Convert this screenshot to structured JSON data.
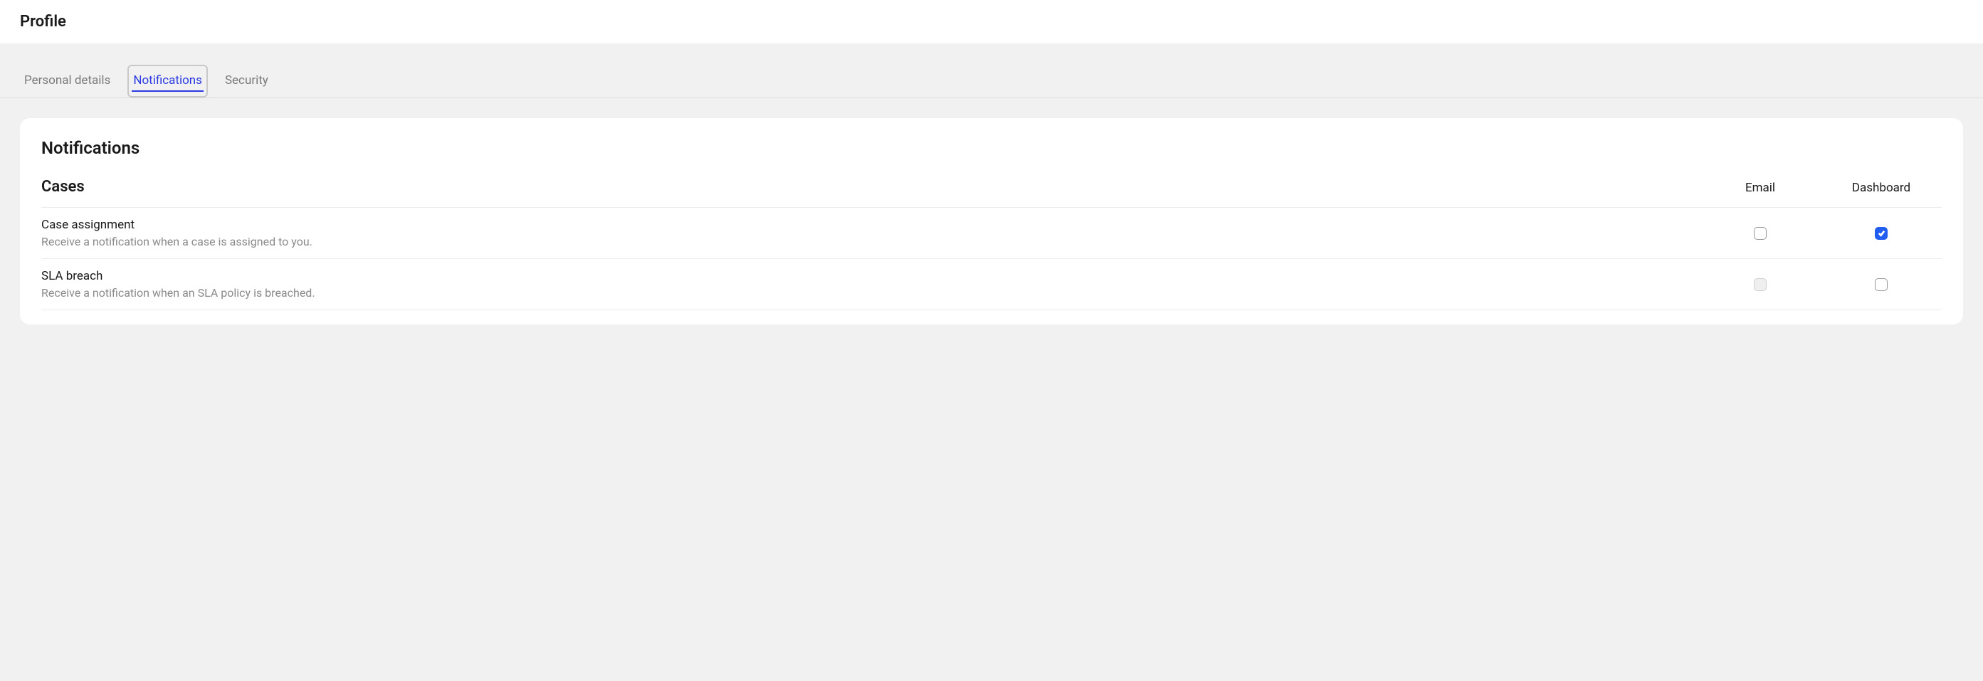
{
  "header": {
    "title": "Profile"
  },
  "tabs": {
    "items": [
      {
        "label": "Personal details",
        "active": false
      },
      {
        "label": "Notifications",
        "active": true
      },
      {
        "label": "Security",
        "active": false
      }
    ]
  },
  "card": {
    "title": "Notifications",
    "section": {
      "title": "Cases",
      "columns": {
        "email": "Email",
        "dashboard": "Dashboard"
      },
      "rows": [
        {
          "title": "Case assignment",
          "description": "Receive a notification when a case is assigned to you.",
          "email": {
            "checked": false,
            "disabled": false
          },
          "dashboard": {
            "checked": true,
            "disabled": false
          }
        },
        {
          "title": "SLA breach",
          "description": "Receive a notification when an SLA policy is breached.",
          "email": {
            "checked": false,
            "disabled": true
          },
          "dashboard": {
            "checked": false,
            "disabled": false
          }
        }
      ]
    }
  }
}
